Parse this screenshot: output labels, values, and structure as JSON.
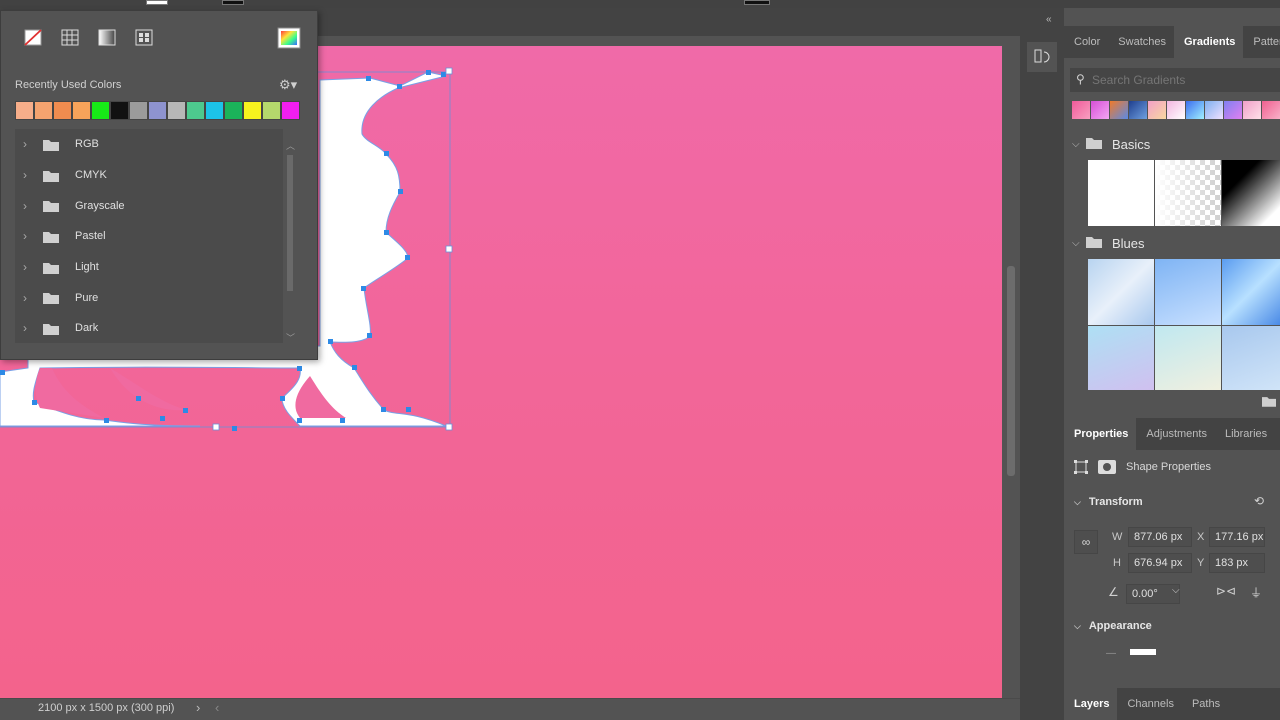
{
  "swatch_popup": {
    "recently_used_label": "Recently Used Colors",
    "recent_colors": [
      "#f7ae8a",
      "#f5a36f",
      "#f08c4f",
      "#f7a35a",
      "#17ea17",
      "#111111",
      "#9b9b9b",
      "#8e93cf",
      "#b7b7b7",
      "#4dc98e",
      "#1cc3e8",
      "#1bb35a",
      "#f7f21e",
      "#b5d86c",
      "#f21ef0"
    ],
    "groups": [
      {
        "label": "RGB"
      },
      {
        "label": "CMYK"
      },
      {
        "label": "Grayscale"
      },
      {
        "label": "Pastel"
      },
      {
        "label": "Light"
      },
      {
        "label": "Pure"
      },
      {
        "label": "Dark"
      }
    ]
  },
  "canvas": {
    "background_top": "#f06aa8",
    "background_bottom": "#f3638c",
    "shape_fill": "#ffffff",
    "anchor_color": "#2d8ae6"
  },
  "statusbar": {
    "doc_info": "2100 px x 1500 px (300 ppi)",
    "chevron": "›",
    "left_chevron": "‹"
  },
  "top_panel": {
    "tabs": [
      {
        "label": "Color",
        "active": false
      },
      {
        "label": "Swatches",
        "active": false
      },
      {
        "label": "Gradients",
        "active": true
      },
      {
        "label": "Patter",
        "active": false
      }
    ],
    "search_placeholder": "Search Gradients",
    "recent_gradients": [
      [
        "#f05a9a",
        "#f8a0c0"
      ],
      [
        "#d64fd6",
        "#f4a6f4"
      ],
      [
        "#f07a2a",
        "#5a8ae6"
      ],
      [
        "#1f3f8f",
        "#6fa0e0"
      ],
      [
        "#f3a0c8",
        "#f8d8a0"
      ],
      [
        "#f2b6e0",
        "#ffffff"
      ],
      [
        "#3c6ff0",
        "#a0f0ff"
      ],
      [
        "#7fb0f0",
        "#f0e0ff"
      ],
      [
        "#8080f0",
        "#e080f0"
      ],
      [
        "#f0a0c8",
        "#ffe0e8"
      ],
      [
        "#f06090",
        "#f8b0c8"
      ]
    ],
    "groups": [
      {
        "label": "Basics"
      },
      {
        "label": "Blues"
      }
    ]
  },
  "bottom_panel": {
    "tabs": [
      {
        "label": "Properties",
        "active": true
      },
      {
        "label": "Adjustments",
        "active": false
      },
      {
        "label": "Libraries",
        "active": false
      }
    ],
    "shape_properties_label": "Shape Properties",
    "transform_label": "Transform",
    "w_label": "W",
    "w_value": "877.06 px",
    "x_label": "X",
    "x_value": "177.16 px",
    "h_label": "H",
    "h_value": "676.94 px",
    "y_label": "Y",
    "y_value": "183 px",
    "angle_value": "0.00°",
    "appearance_label": "Appearance"
  },
  "layers_panel": {
    "tabs": [
      {
        "label": "Layers",
        "active": true
      },
      {
        "label": "Channels",
        "active": false
      },
      {
        "label": "Paths",
        "active": false
      }
    ]
  }
}
